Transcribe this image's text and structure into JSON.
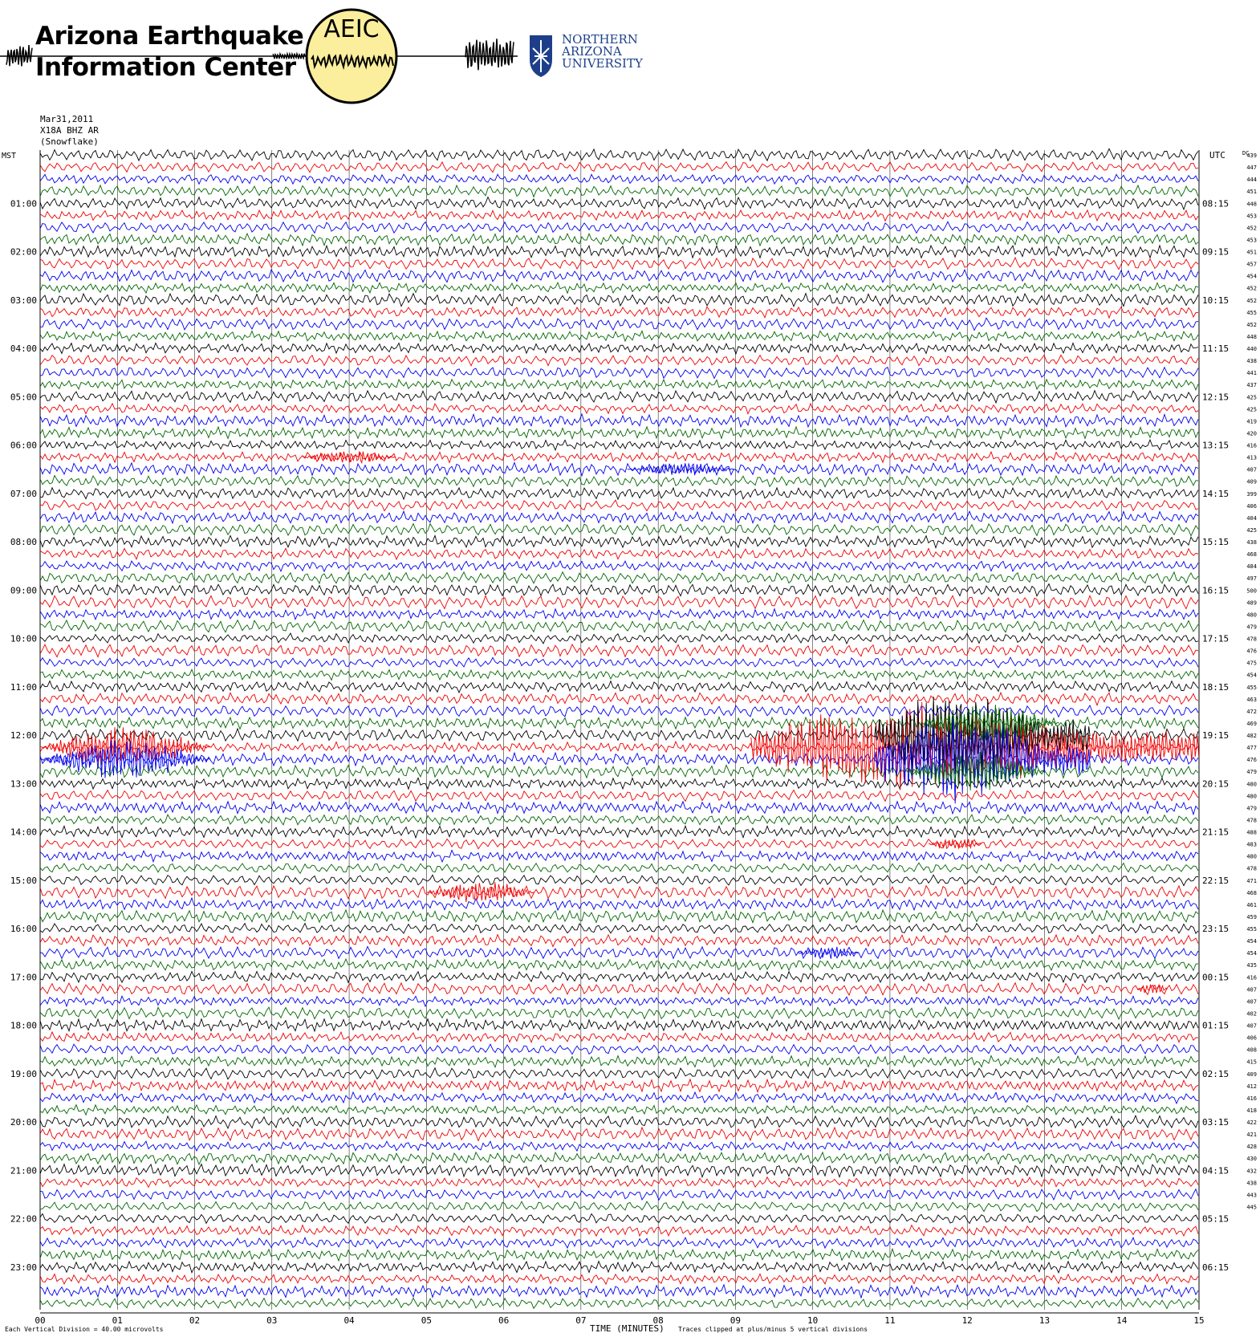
{
  "header": {
    "org_name_line1": "Arizona Earthquake",
    "org_name_line2": "Information Center",
    "logo_text": "AEIC",
    "university_line1": "NORTHERN",
    "university_line2": "ARIZONA",
    "university_line3": "UNIVERSITY"
  },
  "meta": {
    "date": "Mar31,2011",
    "station": "X18A BHZ AR",
    "site": "(Snowflake)"
  },
  "axis": {
    "left_label": "MST",
    "right_label": "UTC",
    "dc_label": "DC",
    "xlabel": "TIME (MINUTES)",
    "footer_left": "Each Vertical Division =    40.00 microvolts",
    "footer_right": "Traces clipped at plus/minus 5 vertical divisions"
  },
  "colors": {
    "trace_cycle": [
      "#000000",
      "#ee0000",
      "#0000ee",
      "#006600"
    ],
    "logo_fill": "#fbee9c",
    "university": "#1d3f8a"
  },
  "chart_data": {
    "type": "line",
    "title": "",
    "xlim": [
      0,
      15
    ],
    "x_ticks": [
      "00",
      "01",
      "02",
      "03",
      "04",
      "05",
      "06",
      "07",
      "08",
      "09",
      "10",
      "11",
      "12",
      "13",
      "14",
      "15"
    ],
    "rows_per_hour": 4,
    "trace_count": 96,
    "grid": true,
    "mst_hour_labels": [
      "01:00",
      "02:00",
      "03:00",
      "04:00",
      "05:00",
      "06:00",
      "07:00",
      "08:00",
      "09:00",
      "10:00",
      "11:00",
      "12:00",
      "13:00",
      "14:00",
      "15:00",
      "16:00",
      "17:00",
      "18:00",
      "19:00",
      "20:00",
      "21:00",
      "22:00",
      "23:00"
    ],
    "utc_hour_labels": [
      "08:15",
      "09:15",
      "10:15",
      "11:15",
      "12:15",
      "13:15",
      "14:15",
      "15:15",
      "16:15",
      "17:15",
      "18:15",
      "19:15",
      "20:15",
      "21:15",
      "22:15",
      "23:15",
      "00:15",
      "01:15",
      "02:15",
      "03:15",
      "04:15",
      "05:15",
      "06:15"
    ],
    "dc_values": [
      439,
      447,
      444,
      451,
      448,
      453,
      452,
      453,
      451,
      457,
      454,
      452,
      452,
      455,
      452,
      448,
      440,
      438,
      441,
      437,
      425,
      425,
      419,
      420,
      416,
      413,
      407,
      409,
      399,
      406,
      404,
      425,
      438,
      468,
      484,
      497,
      500,
      489,
      480,
      479,
      478,
      476,
      475,
      454,
      455,
      463,
      472,
      469,
      482,
      477,
      476,
      479,
      480,
      480,
      479,
      478,
      488,
      483,
      480,
      478,
      471,
      468,
      461,
      459,
      455,
      454,
      454,
      435,
      416,
      407,
      407,
      402,
      407,
      406,
      408,
      415,
      409,
      412,
      416,
      418,
      422,
      421,
      428,
      430,
      432,
      438,
      443,
      445
    ],
    "events": [
      {
        "row": 49,
        "start_min": 9.2,
        "end_min": 15.0,
        "amplitude": "clipped"
      },
      {
        "row": 48,
        "start_min": 10.8,
        "end_min": 13.6,
        "amplitude": "clipped"
      },
      {
        "row": 50,
        "start_min": 10.8,
        "end_min": 13.6,
        "amplitude": "clipped"
      },
      {
        "row": 47,
        "start_min": 11.4,
        "end_min": 13.2,
        "amplitude": "large"
      },
      {
        "row": 51,
        "start_min": 11.2,
        "end_min": 13.0,
        "amplitude": "large"
      },
      {
        "row": 49,
        "start_min": 0.0,
        "end_min": 2.2,
        "amplitude": "large"
      },
      {
        "row": 50,
        "start_min": 0.0,
        "end_min": 2.2,
        "amplitude": "large"
      },
      {
        "row": 25,
        "start_min": 3.4,
        "end_min": 4.6,
        "amplitude": "small"
      },
      {
        "row": 26,
        "start_min": 7.6,
        "end_min": 9.0,
        "amplitude": "small"
      },
      {
        "row": 57,
        "start_min": 11.5,
        "end_min": 12.2,
        "amplitude": "small"
      },
      {
        "row": 61,
        "start_min": 5.0,
        "end_min": 6.4,
        "amplitude": "moderate"
      },
      {
        "row": 66,
        "start_min": 9.8,
        "end_min": 10.6,
        "amplitude": "small"
      },
      {
        "row": 69,
        "start_min": 14.2,
        "end_min": 14.6,
        "amplitude": "small"
      }
    ]
  }
}
